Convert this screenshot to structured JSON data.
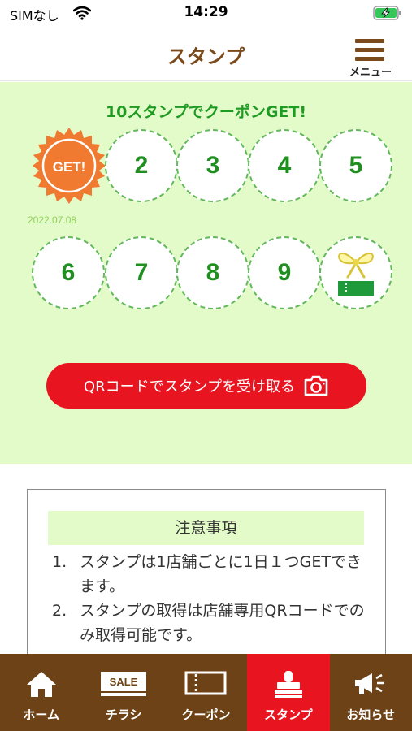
{
  "status_bar": {
    "carrier": "SIMなし",
    "time": "14:29"
  },
  "header": {
    "title": "スタンプ",
    "menu_label": "メニュー"
  },
  "stamp_card": {
    "heading": "10スタンプでクーポンGET!",
    "get_badge_text": "GET!",
    "stamps": [
      "2",
      "3",
      "4",
      "5",
      "6",
      "7",
      "8",
      "9"
    ],
    "first_stamp_date": "2022.07.08",
    "collected_count": 1,
    "total_stamps": 10
  },
  "qr_button": {
    "label": "QRコードでスタンプを受け取る"
  },
  "notes": {
    "title": "注意事項",
    "items": [
      {
        "num": "1.",
        "text": "スタンプは1店舗ごとに1日１つGETできます。"
      },
      {
        "num": "2.",
        "text": "スタンプの取得は店舗専用QRコードでのみ取得可能です。"
      }
    ]
  },
  "tab_bar": {
    "items": [
      {
        "label": "ホーム",
        "icon": "home-icon"
      },
      {
        "label": "チラシ",
        "icon": "sale-flyer-icon",
        "icon_text": "SALE"
      },
      {
        "label": "クーポン",
        "icon": "coupon-ticket-icon"
      },
      {
        "label": "スタンプ",
        "icon": "stamp-icon",
        "active": true
      },
      {
        "label": "お知らせ",
        "icon": "megaphone-icon"
      }
    ]
  },
  "colors": {
    "brand_brown": "#7a4a1c",
    "tab_bar_bg": "#6e4217",
    "accent_red": "#e8141f",
    "card_green_bg": "#e3fbc8",
    "stamp_green": "#1f8f1f",
    "get_badge_orange": "#f07a2f"
  }
}
